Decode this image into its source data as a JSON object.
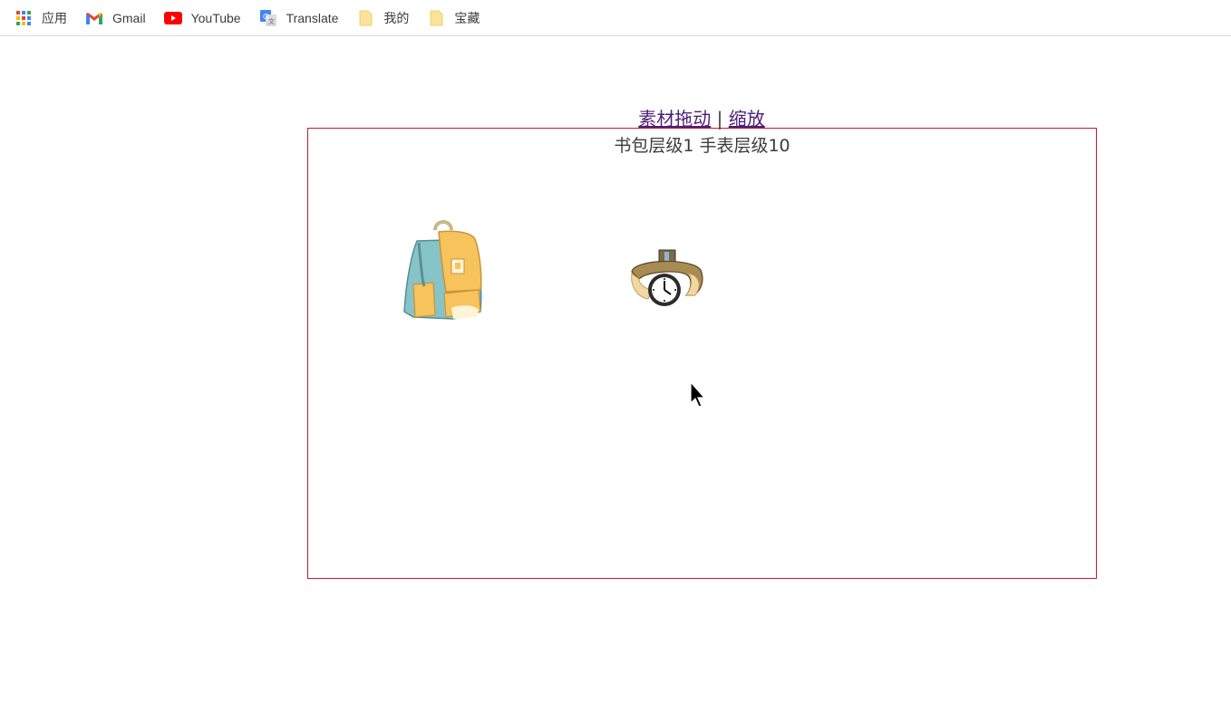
{
  "bookmarks": {
    "apps_label": "应用",
    "gmail_label": "Gmail",
    "youtube_label": "YouTube",
    "translate_label": "Translate",
    "folder_mine_label": "我的",
    "folder_treasure_label": "宝藏"
  },
  "page": {
    "link_drag": "素材拖动",
    "separator": "|",
    "link_zoom": "缩放",
    "caption": "书包层级1 手表层级10"
  },
  "colors": {
    "stage_border": "#c41a2b",
    "link": "#4b1f78",
    "text": "#3c3c3c"
  },
  "icons": [
    "apps-grid-icon",
    "gmail-icon",
    "youtube-icon",
    "translate-icon",
    "folder-icon",
    "backpack-image",
    "watch-image",
    "mouse-cursor-icon"
  ]
}
